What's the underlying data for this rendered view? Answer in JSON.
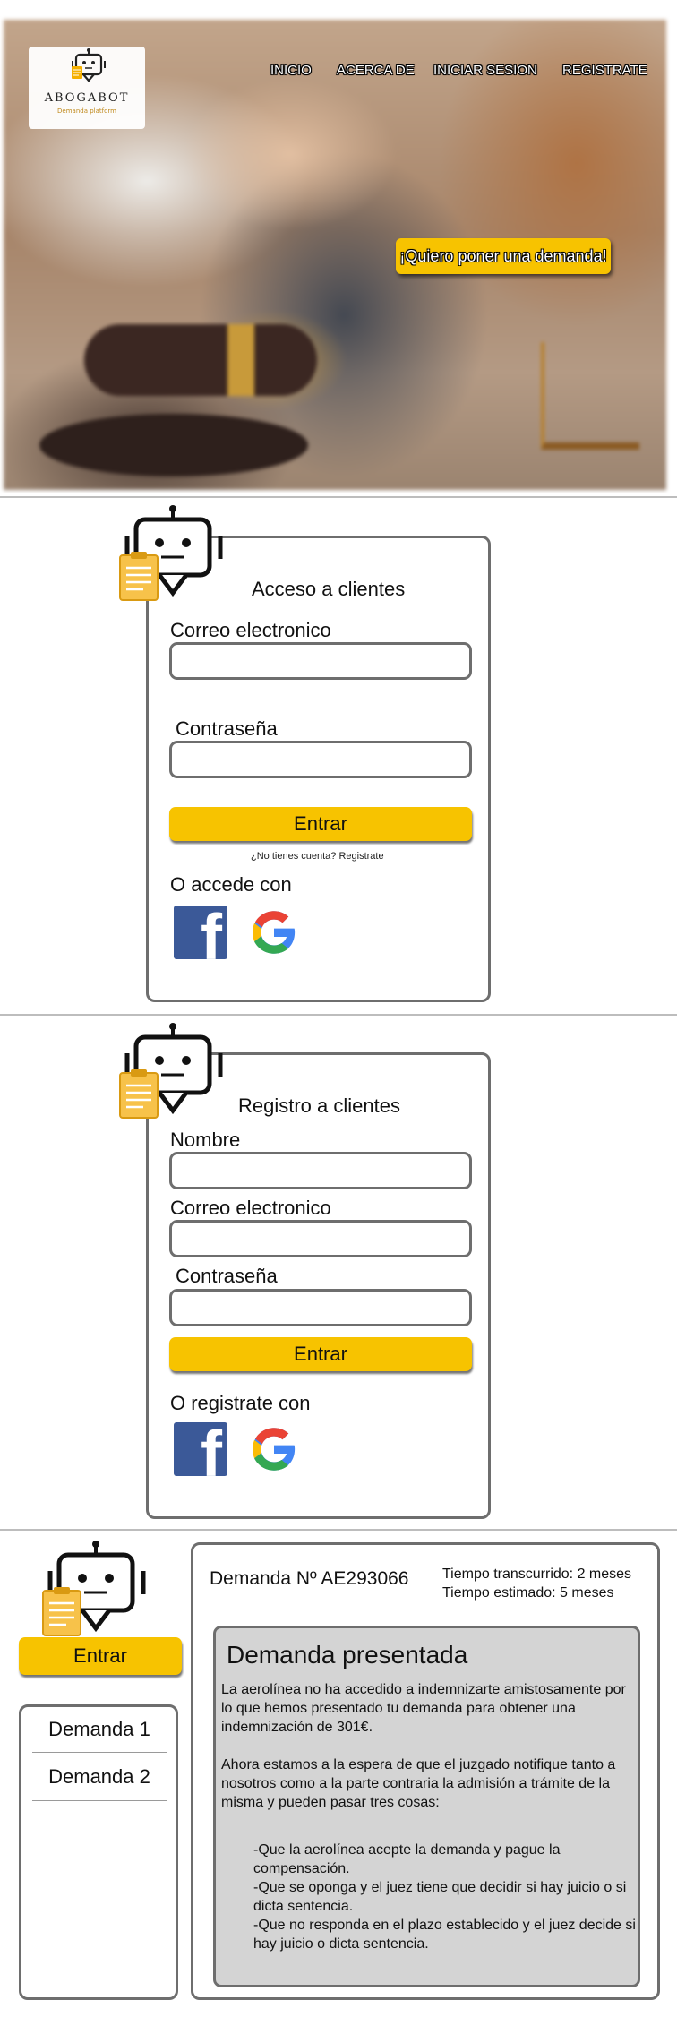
{
  "brand": {
    "name": "ABOGABOT",
    "tagline": "Demanda platform"
  },
  "nav": {
    "items": [
      "INICIO",
      "ACERCA DE",
      "INICIAR SESION",
      "REGISTRATE"
    ]
  },
  "hero": {
    "cta_label": "¡Quiero poner una demanda!"
  },
  "login": {
    "title": "Acceso a clientes",
    "email_label": "Correo electronico",
    "password_label": "Contraseña",
    "submit_label": "Entrar",
    "register_link": "¿No tienes cuenta? Registrate",
    "alt_login_label": "O accede con"
  },
  "register": {
    "title": "Registro a clientes",
    "name_label": "Nombre",
    "email_label": "Correo electronico",
    "password_label": "Contraseña",
    "submit_label": "Entrar",
    "alt_register_label": "O registrate con"
  },
  "dashboard": {
    "enter_label": "Entrar",
    "demands": [
      "Demanda 1",
      "Demanda 2"
    ],
    "demand_number": "Demanda Nº AE293066",
    "time_elapsed": "Tiempo transcurrido: 2 meses",
    "time_estimated": "Tiempo estimado: 5 meses",
    "status_title": "Demanda presentada",
    "paragraph_1": "La aerolínea no ha accedido a indemnizarte amistosamente por lo que hemos presentado tu demanda para obtener una indemnización de 301€.",
    "paragraph_2": "Ahora estamos a la espera de que el juzgado notifique tanto  a nosotros como a la parte contraria la admisión a trámite de la misma y pueden pasar tres cosas:",
    "outcomes": [
      "-Que la aerolínea acepte la demanda y pague la compensación.",
      "-Que se oponga y el juez tiene que decidir si hay juicio o si dicta sentencia.",
      "-Que no responda en el plazo establecido y el juez decide si hay juicio o dicta sentencia."
    ]
  },
  "colors": {
    "accent_yellow": "#f7c300",
    "border_gray": "#6e6e6e",
    "status_bg": "#d4d4d4",
    "facebook_blue": "#3b5998"
  },
  "icons": {
    "robot": "robot-chat-icon",
    "document": "document-icon",
    "facebook": "facebook-icon",
    "google": "google-icon"
  }
}
